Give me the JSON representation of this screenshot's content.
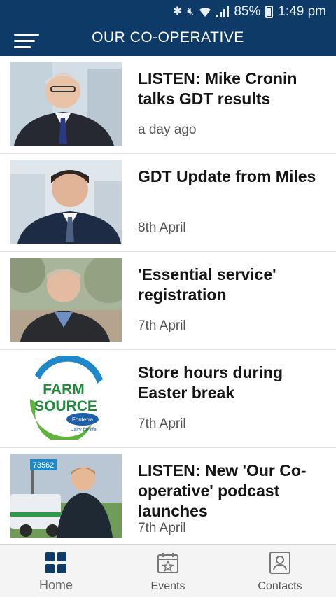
{
  "status_bar": {
    "battery": "85%",
    "time": "1:49 pm"
  },
  "header": {
    "title": "OUR CO-OPERATIVE"
  },
  "articles": [
    {
      "title": "LISTEN: Mike Cronin talks GDT results",
      "date": "a day ago",
      "thumbnail": "person-portrait"
    },
    {
      "title": "GDT Update from Miles",
      "date": "8th April",
      "thumbnail": "person-portrait"
    },
    {
      "title": "'Essential service' registration",
      "date": "7th April",
      "thumbnail": "person-portrait"
    },
    {
      "title": "Store hours during Easter break",
      "date": "7th April",
      "thumbnail": "farm-source-logo",
      "logo": {
        "line1": "FARM",
        "line2": "SOURCE",
        "brand": "Fonterra",
        "tagline": "Dairy for life"
      }
    },
    {
      "title": "LISTEN: New 'Our Co-operative' podcast launches",
      "date": "7th April",
      "thumbnail": "person-with-vehicle",
      "sign_text": "73562"
    }
  ],
  "tabs": [
    {
      "label": "Home",
      "icon": "grid-icon",
      "active": true
    },
    {
      "label": "Events",
      "icon": "calendar-star-icon",
      "active": false
    },
    {
      "label": "Contacts",
      "icon": "contact-card-icon",
      "active": false
    }
  ],
  "colors": {
    "header": "#0d3a66",
    "tab_icon_active": "#0d3a66",
    "tab_icon": "#777777"
  }
}
